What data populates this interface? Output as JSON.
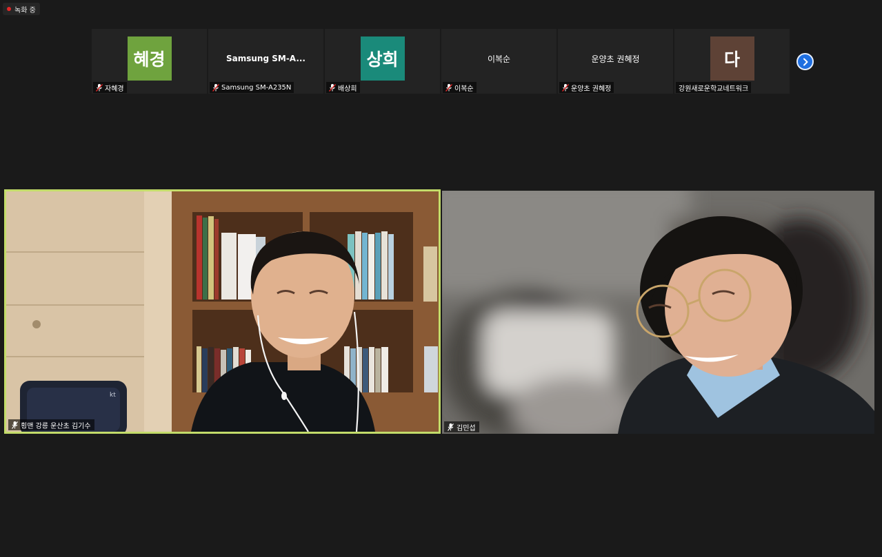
{
  "recording": {
    "label": "녹화 중",
    "indicator_color": "#e02828"
  },
  "participants_strip": [
    {
      "type": "avatar",
      "avatar_text": "혜경",
      "avatar_color": "#6fa33e",
      "name": "자혜경",
      "muted": true
    },
    {
      "type": "name",
      "center_text": "Samsung  SM-A...",
      "name": "Samsung SM-A235N",
      "muted": true
    },
    {
      "type": "avatar",
      "avatar_text": "상희",
      "avatar_color": "#1a8a7a",
      "name": "배상희",
      "muted": true
    },
    {
      "type": "plain",
      "center_text": "이복순",
      "name": "이복순",
      "muted": true
    },
    {
      "type": "plain",
      "center_text": "운양초 권혜정",
      "name": "운양초 권혜정",
      "muted": true
    },
    {
      "type": "avatar",
      "avatar_text": "다",
      "avatar_color": "#5e4236",
      "name": "강원새로운학교네트워크",
      "muted": false
    }
  ],
  "next_page_icon": "chevron-right-icon",
  "videos": [
    {
      "name": "횡맨 강릉 운산초 김기수",
      "active_speaker": true,
      "highlight_color": "#c3dc6a"
    },
    {
      "name": "김민섭",
      "active_speaker": false
    }
  ]
}
